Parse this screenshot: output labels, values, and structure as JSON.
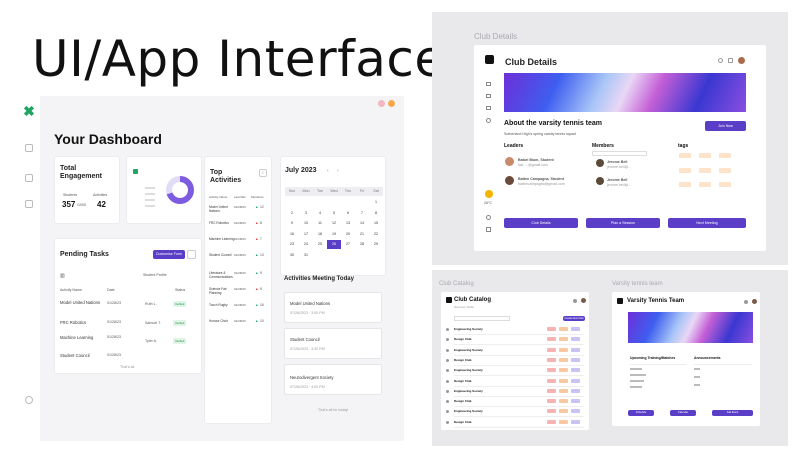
{
  "hero": {
    "title": "UI/App Interface"
  },
  "dashboard": {
    "title": "Your Dashboard",
    "engagement": {
      "title_line1": "Total",
      "title_line2": "Engagement",
      "students_label": "Students",
      "students_value": "357",
      "students_suffix": "/1000",
      "activities_label": "Activities",
      "activities_value": "42"
    },
    "pending": {
      "title": "Pending Tasks",
      "button": "Customise Form",
      "columns": [
        "Activity Name",
        "Date",
        "Student Profile",
        "Status"
      ],
      "rows": [
        {
          "name": "Model United Nations",
          "date": "01/28/23",
          "student": "Ruth L.",
          "status": "Verified"
        },
        {
          "name": "FRC Robotics",
          "date": "01/28/23",
          "student": "Samuel T.",
          "status": "Verified"
        },
        {
          "name": "Machine Learning",
          "date": "01/28/23",
          "student": "Tyler A.",
          "status": "Verified"
        },
        {
          "name": "Student Council",
          "date": "01/28/23",
          "student": "",
          "status": ""
        }
      ],
      "footer": "That's all"
    },
    "top_activities": {
      "title_line1": "Top",
      "title_line2": "Activities",
      "columns": [
        "Activity Name",
        "Last Met",
        "Members"
      ],
      "rows": [
        {
          "name": "Model United Nations",
          "date": "01/28/23",
          "members": "12"
        },
        {
          "name": "FRC Robotics",
          "date": "01/28/23",
          "members": "8"
        },
        {
          "name": "Machine Learning",
          "date": "01/28/23",
          "members": "7"
        },
        {
          "name": "Student Council",
          "date": "01/28/23",
          "members": "13"
        },
        {
          "name": "Literature & Communications",
          "date": "01/28/23",
          "members": "9"
        },
        {
          "name": "Science Fair Planning",
          "date": "01/28/23",
          "members": "5"
        },
        {
          "name": "Touch Rugby",
          "date": "01/28/23",
          "members": "16"
        },
        {
          "name": "Honour Choir",
          "date": "01/28/23",
          "members": "10"
        }
      ]
    },
    "calendar": {
      "month": "July 2023",
      "weekdays": [
        "Sun",
        "Mon",
        "Tue",
        "Wed",
        "Thu",
        "Fri",
        "Sat"
      ],
      "days": [
        "",
        "",
        "",
        "",
        "",
        "",
        "1",
        "2",
        "3",
        "4",
        "5",
        "6",
        "7",
        "8",
        "9",
        "10",
        "11",
        "12",
        "13",
        "14",
        "15",
        "16",
        "17",
        "18",
        "19",
        "20",
        "21",
        "22",
        "23",
        "24",
        "25",
        "26",
        "27",
        "28",
        "29",
        "30",
        "31"
      ],
      "selected": "26"
    },
    "meetings": {
      "title": "Activities Meeting Today",
      "items": [
        {
          "name": "Model United Nations",
          "time": "07/26/2023 · 3:00 PM"
        },
        {
          "name": "Student Council",
          "time": "07/26/2023 · 3:30 PM"
        },
        {
          "name": "Neurodivergent Society",
          "time": "07/26/2023 · 4:00 PM"
        }
      ],
      "footer": "That's all for today!"
    },
    "accent": "#5b3ec8",
    "brand_green": "#1fa463"
  },
  "club_details": {
    "label": "Club Details",
    "title": "Club Details",
    "team_title": "About the varsity tennis team",
    "subtitle": "Sutherland High's spring varsity tennis squad",
    "join_button": "Join Now",
    "leaders_title": "Leaders",
    "members_title": "Members",
    "tags_title": "tags",
    "leaders": [
      {
        "name": "Batori Blum, Student",
        "email": "bat.....@gmail.com"
      },
      {
        "name": "Batten Campagna, Student",
        "email": "battencampagna@gmail.com"
      }
    ],
    "members": [
      {
        "name": "Jerome Bell",
        "email": "jerome.bell@..."
      },
      {
        "name": "Jerome Bell",
        "email": "jerome.bell@..."
      }
    ],
    "bottom_buttons": [
      "Club Details",
      "Plan a Session",
      "Next Meeting"
    ],
    "weather": "26°C"
  },
  "club_catalog": {
    "label": "Club Catalog",
    "title": "Club Catalog",
    "subtitle": "Discover Clubs",
    "button": "Create New Club",
    "rows": [
      "Engineering Society",
      "Design Club",
      "Engineering Society",
      "Design Club",
      "Engineering Society",
      "Design Club",
      "Engineering Society",
      "Design Club",
      "Engineering Society",
      "Design Club"
    ]
  },
  "varsity": {
    "label": "Varsity tennis team",
    "title": "Varsity Tennis Team",
    "col1": "Upcoming Training/Matches",
    "col2": "Announcements",
    "buttons": [
      "Schedule",
      "Calendar",
      "Add Event"
    ]
  }
}
